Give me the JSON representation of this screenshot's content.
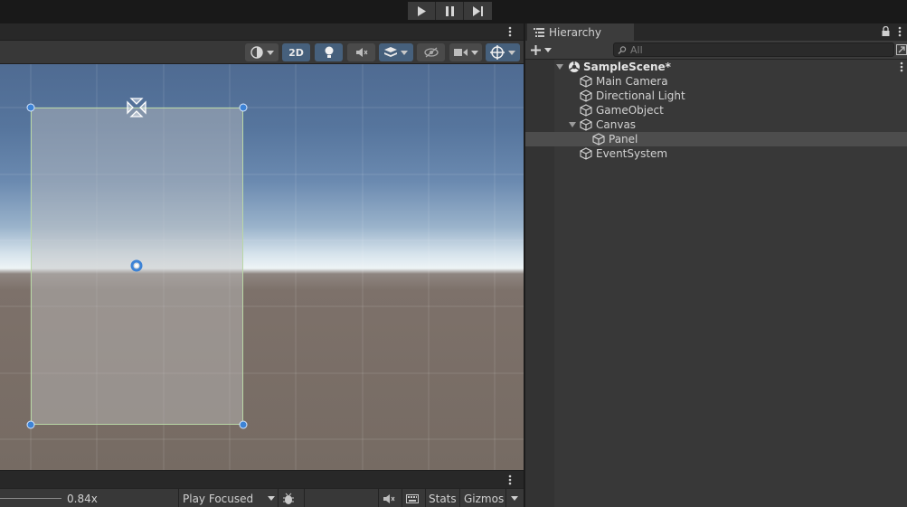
{
  "toolbar": {
    "play_icon": "play-icon",
    "pause_icon": "pause-icon",
    "step_icon": "step-icon"
  },
  "scene": {
    "mode_2d": "2D",
    "icons": [
      "shading-mode-icon",
      "lighting-icon",
      "audio-icon",
      "effects-icon",
      "visibility-icon",
      "camera-icon",
      "gizmo-icon"
    ]
  },
  "game_bar": {
    "scale_value": "0.84x",
    "play_mode": "Play Focused",
    "stats": "Stats",
    "gizmos": "Gizmos"
  },
  "hierarchy": {
    "tab_label": "Hierarchy",
    "search_placeholder": "All",
    "scene_name": "SampleScene*",
    "items": [
      {
        "label": "Main Camera",
        "depth": 1,
        "selected": false,
        "has_children": false
      },
      {
        "label": "Directional Light",
        "depth": 1,
        "selected": false,
        "has_children": false
      },
      {
        "label": "GameObject",
        "depth": 1,
        "selected": false,
        "has_children": false
      },
      {
        "label": "Canvas",
        "depth": 1,
        "selected": false,
        "has_children": true
      },
      {
        "label": "Panel",
        "depth": 2,
        "selected": true,
        "has_children": false
      },
      {
        "label": "EventSystem",
        "depth": 1,
        "selected": false,
        "has_children": false
      }
    ]
  },
  "colors": {
    "accent_blue": "#46607c",
    "handle_blue": "#3d83d6",
    "selection_row": "#4d4d4d"
  }
}
